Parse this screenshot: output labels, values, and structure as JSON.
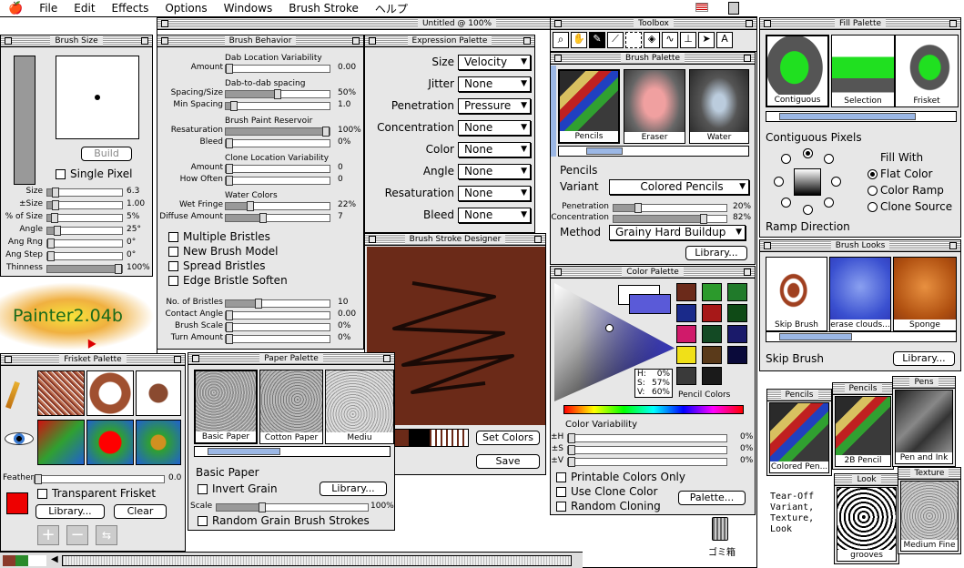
{
  "menubar": {
    "apple": "",
    "items": [
      "File",
      "Edit",
      "Effects",
      "Options",
      "Windows",
      "Brush Stroke",
      "ヘルプ"
    ]
  },
  "document": {
    "title": "Untitled @ 100%"
  },
  "brush_size": {
    "title": "Brush Size",
    "build": "Build",
    "single_pixel": "Single Pixel",
    "rows": [
      {
        "label": "Size",
        "value": "6.3",
        "pos": 0.07
      },
      {
        "label": "±Size",
        "value": "1.00",
        "pos": 0.07
      },
      {
        "label": "% of Size",
        "value": "5%",
        "pos": 0.05
      },
      {
        "label": "Angle",
        "value": "25°",
        "pos": 0.1
      },
      {
        "label": "Ang Rng",
        "value": "0°",
        "pos": 0
      },
      {
        "label": "Ang Step",
        "value": "0°",
        "pos": 0
      },
      {
        "label": "Thinness",
        "value": "100%",
        "pos": 1
      }
    ]
  },
  "brush_behavior": {
    "title": "Brush Behavior",
    "sections": [
      {
        "head": "Dab Location Variability",
        "rows": [
          {
            "label": "Amount",
            "value": "0.00",
            "pos": 0
          }
        ]
      },
      {
        "head": "Dab-to-dab spacing",
        "rows": [
          {
            "label": "Spacing/Size",
            "value": "50%",
            "pos": 0.5
          },
          {
            "label": "Min Spacing",
            "value": "1.0",
            "pos": 0.05
          }
        ]
      },
      {
        "head": "Brush Paint Reservoir",
        "rows": [
          {
            "label": "Resaturation",
            "value": "100%",
            "pos": 1
          },
          {
            "label": "Bleed",
            "value": "0%",
            "pos": 0
          }
        ]
      },
      {
        "head": "Clone Location Variability",
        "rows": [
          {
            "label": "Amount",
            "value": "0",
            "pos": 0
          },
          {
            "label": "How Often",
            "value": "0",
            "pos": 0
          }
        ]
      },
      {
        "head": "Water Colors",
        "rows": [
          {
            "label": "Wet Fringe",
            "value": "22%",
            "pos": 0.22
          },
          {
            "label": "Diffuse Amount",
            "value": "7",
            "pos": 0.35
          }
        ]
      }
    ],
    "checks": [
      "Multiple Bristles",
      "New Brush Model",
      "Spread Bristles",
      "Edge Bristle Soften"
    ],
    "bottom": [
      {
        "label": "No. of Bristles",
        "value": "10",
        "pos": 0.3
      },
      {
        "label": "Contact Angle",
        "value": "0.00",
        "pos": 0
      },
      {
        "label": "Brush Scale",
        "value": "0%",
        "pos": 0
      },
      {
        "label": "Turn Amount",
        "value": "0%",
        "pos": 0
      }
    ]
  },
  "expression": {
    "title": "Expression Palette",
    "rows": [
      {
        "label": "Size",
        "value": "Velocity"
      },
      {
        "label": "Jitter",
        "value": "None"
      },
      {
        "label": "Penetration",
        "value": "Pressure"
      },
      {
        "label": "Concentration",
        "value": "None"
      },
      {
        "label": "Color",
        "value": "None"
      },
      {
        "label": "Angle",
        "value": "None"
      },
      {
        "label": "Resaturation",
        "value": "None"
      },
      {
        "label": "Bleed",
        "value": "None"
      }
    ]
  },
  "stroke_designer": {
    "title": "Brush Stroke Designer",
    "set_colors": "Set Colors",
    "save": "Save"
  },
  "toolbox": {
    "title": "Toolbox"
  },
  "brush_palette": {
    "title": "Brush Palette",
    "brushes": [
      "Pencils",
      "Eraser",
      "Water"
    ],
    "category": "Pencils",
    "variant_label": "Variant",
    "variant": "Colored Pencils",
    "rows": [
      {
        "label": "Penetration",
        "value": "20%",
        "pos": 0.2
      },
      {
        "label": "Concentration",
        "value": "82%",
        "pos": 0.82
      }
    ],
    "method_label": "Method",
    "method": "Grainy Hard Buildup",
    "library": "Library..."
  },
  "color_palette": {
    "title": "Color Palette",
    "hsv": {
      "h": "0%",
      "s": "57%",
      "v": "60%"
    },
    "set_name": "Pencil Colors",
    "variability": "Color Variability",
    "var_rows": [
      {
        "label": "±H",
        "value": "0%"
      },
      {
        "label": "±S",
        "value": "0%"
      },
      {
        "label": "±V",
        "value": "0%"
      }
    ],
    "checks": [
      "Printable Colors Only",
      "Use Clone Color",
      "Random Cloning"
    ],
    "palette_btn": "Palette...",
    "swatches": [
      "#6b2a1a",
      "#2c9a2c",
      "#207a2a",
      "#1a2a8a",
      "#a71818",
      "#0f4a16",
      "#d01a6a",
      "#134a24",
      "#1a1a6a",
      "#f0e018",
      "#5a3a1a",
      "#0a0a3a",
      "#3a3a3a",
      "#1a1a1a"
    ]
  },
  "fill_palette": {
    "title": "Fill Palette",
    "items": [
      "Contiguous P...",
      "Selection",
      "Frisket"
    ],
    "mode": "Contiguous Pixels",
    "fill_with": "Fill With",
    "options": [
      "Flat Color",
      "Color Ramp",
      "Clone Source"
    ],
    "ramp_direction": "Ramp Direction"
  },
  "brush_looks": {
    "title": "Brush Looks",
    "items": [
      "Skip Brush",
      "erase clouds...",
      "Sponge"
    ],
    "current": "Skip Brush",
    "library": "Library..."
  },
  "frisket": {
    "title": "Frisket Palette",
    "feather_label": "Feather",
    "feather": "0.0",
    "transparent": "Transparent Frisket",
    "library": "Library...",
    "clear": "Clear"
  },
  "paper": {
    "title": "Paper Palette",
    "items": [
      "Basic Paper",
      "Cotton Paper",
      "Mediu"
    ],
    "current": "Basic Paper",
    "invert": "Invert Grain",
    "library": "Library...",
    "scale_label": "Scale",
    "scale": "100%",
    "random": "Random Grain Brush Strokes"
  },
  "logo": {
    "text": "Painter2.04b"
  },
  "tearoffs": {
    "pencils": {
      "title": "Pencils",
      "cap": "Colored Pen..."
    },
    "pencils2": {
      "title": "Pencils",
      "cap": "2B Pencil"
    },
    "pens": {
      "title": "Pens",
      "cap": "Pen and Ink"
    },
    "look": {
      "title": "Look",
      "cap": "grooves"
    },
    "texture": {
      "title": "Texture",
      "cap": "Medium Fine"
    },
    "note": "Tear-Off\nVariant,\nTexture,\nLook"
  },
  "desktop": {
    "trash": "ゴミ箱"
  }
}
